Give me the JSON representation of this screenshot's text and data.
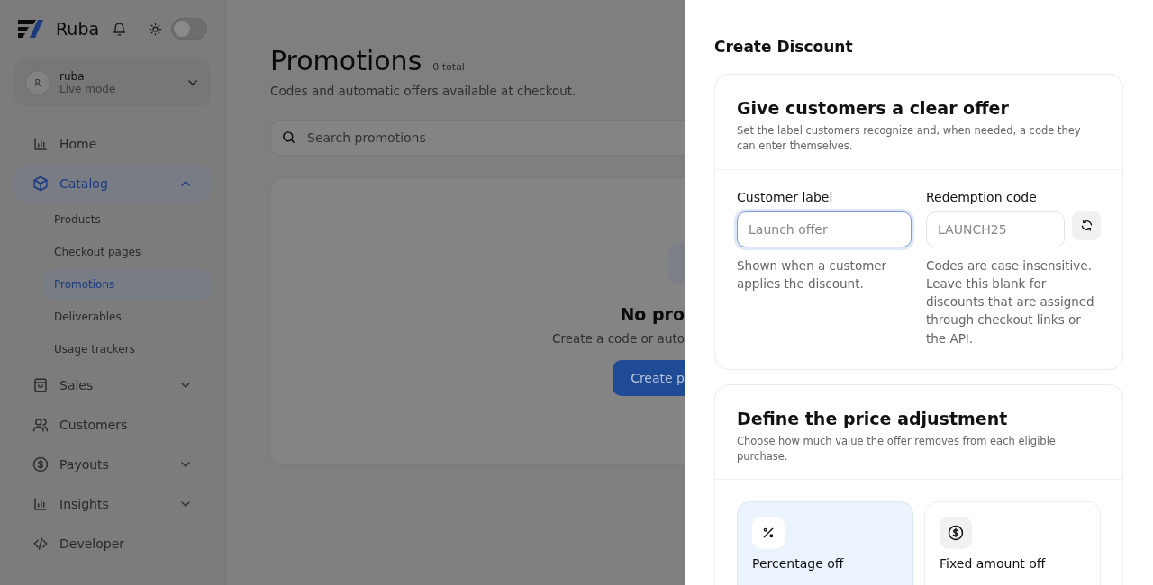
{
  "sidebar": {
    "brand": "Ruba",
    "theme_toggle": {
      "on": false
    },
    "account": {
      "initial": "R",
      "name": "ruba",
      "mode": "Live mode"
    },
    "items": [
      {
        "label": "Home",
        "kind": "chart",
        "selected": false
      },
      {
        "label": "Catalog",
        "kind": "box",
        "selected": true,
        "expanded": true,
        "children": [
          {
            "label": "Products",
            "selected": false
          },
          {
            "label": "Checkout pages",
            "selected": false
          },
          {
            "label": "Promotions",
            "selected": true
          },
          {
            "label": "Deliverables",
            "selected": false
          },
          {
            "label": "Usage trackers",
            "selected": false
          }
        ]
      },
      {
        "label": "Sales",
        "kind": "bag",
        "selected": false,
        "expanded": false
      },
      {
        "label": "Customers",
        "kind": "users",
        "selected": false
      },
      {
        "label": "Payouts",
        "kind": "dollar",
        "selected": false,
        "expanded": false
      },
      {
        "label": "Insights",
        "kind": "chart",
        "selected": false,
        "expanded": false
      },
      {
        "label": "Developer",
        "kind": "code",
        "selected": false
      }
    ]
  },
  "page": {
    "title": "Promotions",
    "count": "0 total",
    "subtitle": "Codes and automatic offers available at checkout.",
    "search": {
      "placeholder": "Search promotions"
    },
    "empty_state": {
      "title": "No pro",
      "text": "Create a code or auto",
      "button": "Create p"
    }
  },
  "drawer": {
    "title": "Create Discount",
    "offer_section": {
      "heading": "Give customers a clear offer",
      "description": "Set the label customers recognize and, when needed, a code they can enter themselves.",
      "fields": [
        {
          "label": "Customer label",
          "placeholder": "Launch offer",
          "help": "Shown when a customer applies the discount.",
          "focused": true,
          "kind": "text"
        },
        {
          "label": "Redemption code",
          "placeholder": "LAUNCH25",
          "help": "Codes are case insensitive. Leave this blank for discounts that are assigned through checkout links or the API.",
          "focused": false,
          "kind": "code"
        }
      ]
    },
    "price_section": {
      "heading": "Define the price adjustment",
      "description": "Choose how much value the offer removes from each eligible purchase.",
      "options": [
        {
          "kind": "percent",
          "title": "Percentage off",
          "selected": true
        },
        {
          "kind": "fixed",
          "title": "Fixed amount off",
          "selected": false
        }
      ]
    }
  }
}
